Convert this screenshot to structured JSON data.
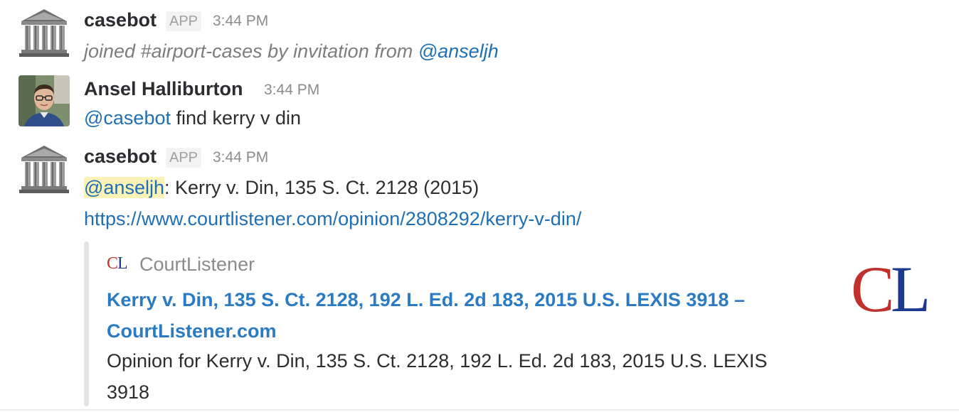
{
  "messages": [
    {
      "author": "casebot",
      "badge": "APP",
      "time": "3:44 PM",
      "meta_prefix": "joined #airport-cases by invitation from",
      "meta_mention": "@anseljh"
    },
    {
      "author": "Ansel Halliburton",
      "time": "3:44 PM",
      "mention": "@casebot",
      "text": "find kerry v din"
    },
    {
      "author": "casebot",
      "badge": "APP",
      "time": "3:44 PM",
      "mention": "@anseljh",
      "text": ": Kerry v. Din, 135 S. Ct. 2128 (2015)",
      "url": "https://www.courtlistener.com/opinion/2808292/kerry-v-din/"
    }
  ],
  "attachment": {
    "service_icon_text": "CL",
    "service_name": "CourtListener",
    "title": "Kerry v. Din, 135 S. Ct. 2128, 192 L. Ed. 2d 183, 2015 U.S. LEXIS 3918 – CourtListener.com",
    "description": "Opinion for Kerry v. Din, 135 S. Ct. 2128, 192 L. Ed. 2d 183, 2015 U.S. LEXIS 3918",
    "thumb_text": "CL"
  },
  "colors": {
    "link": "#1f6fb5",
    "mention_highlight": "#fbf2b8",
    "cl_red": "#c0302c",
    "cl_blue": "#1d3a8f"
  },
  "icons": {
    "casebot_avatar": "courthouse-icon",
    "ansel_avatar": "user-photo"
  }
}
